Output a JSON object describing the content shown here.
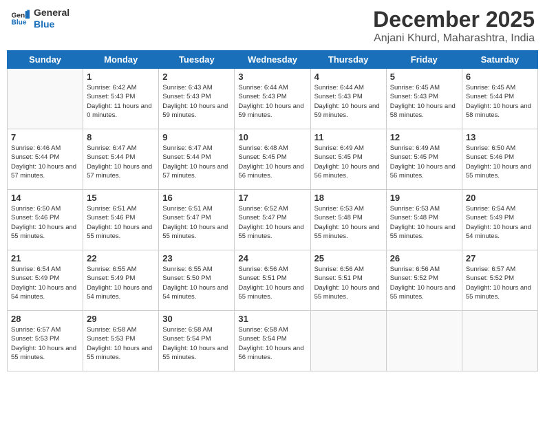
{
  "header": {
    "logo_line1": "General",
    "logo_line2": "Blue",
    "month": "December 2025",
    "location": "Anjani Khurd, Maharashtra, India"
  },
  "weekdays": [
    "Sunday",
    "Monday",
    "Tuesday",
    "Wednesday",
    "Thursday",
    "Friday",
    "Saturday"
  ],
  "weeks": [
    [
      {
        "day": "",
        "sunrise": "",
        "sunset": "",
        "daylight": ""
      },
      {
        "day": "1",
        "sunrise": "6:42 AM",
        "sunset": "5:43 PM",
        "daylight": "11 hours and 0 minutes."
      },
      {
        "day": "2",
        "sunrise": "6:43 AM",
        "sunset": "5:43 PM",
        "daylight": "10 hours and 59 minutes."
      },
      {
        "day": "3",
        "sunrise": "6:44 AM",
        "sunset": "5:43 PM",
        "daylight": "10 hours and 59 minutes."
      },
      {
        "day": "4",
        "sunrise": "6:44 AM",
        "sunset": "5:43 PM",
        "daylight": "10 hours and 59 minutes."
      },
      {
        "day": "5",
        "sunrise": "6:45 AM",
        "sunset": "5:43 PM",
        "daylight": "10 hours and 58 minutes."
      },
      {
        "day": "6",
        "sunrise": "6:45 AM",
        "sunset": "5:44 PM",
        "daylight": "10 hours and 58 minutes."
      }
    ],
    [
      {
        "day": "7",
        "sunrise": "6:46 AM",
        "sunset": "5:44 PM",
        "daylight": "10 hours and 57 minutes."
      },
      {
        "day": "8",
        "sunrise": "6:47 AM",
        "sunset": "5:44 PM",
        "daylight": "10 hours and 57 minutes."
      },
      {
        "day": "9",
        "sunrise": "6:47 AM",
        "sunset": "5:44 PM",
        "daylight": "10 hours and 57 minutes."
      },
      {
        "day": "10",
        "sunrise": "6:48 AM",
        "sunset": "5:45 PM",
        "daylight": "10 hours and 56 minutes."
      },
      {
        "day": "11",
        "sunrise": "6:49 AM",
        "sunset": "5:45 PM",
        "daylight": "10 hours and 56 minutes."
      },
      {
        "day": "12",
        "sunrise": "6:49 AM",
        "sunset": "5:45 PM",
        "daylight": "10 hours and 56 minutes."
      },
      {
        "day": "13",
        "sunrise": "6:50 AM",
        "sunset": "5:46 PM",
        "daylight": "10 hours and 55 minutes."
      }
    ],
    [
      {
        "day": "14",
        "sunrise": "6:50 AM",
        "sunset": "5:46 PM",
        "daylight": "10 hours and 55 minutes."
      },
      {
        "day": "15",
        "sunrise": "6:51 AM",
        "sunset": "5:46 PM",
        "daylight": "10 hours and 55 minutes."
      },
      {
        "day": "16",
        "sunrise": "6:51 AM",
        "sunset": "5:47 PM",
        "daylight": "10 hours and 55 minutes."
      },
      {
        "day": "17",
        "sunrise": "6:52 AM",
        "sunset": "5:47 PM",
        "daylight": "10 hours and 55 minutes."
      },
      {
        "day": "18",
        "sunrise": "6:53 AM",
        "sunset": "5:48 PM",
        "daylight": "10 hours and 55 minutes."
      },
      {
        "day": "19",
        "sunrise": "6:53 AM",
        "sunset": "5:48 PM",
        "daylight": "10 hours and 55 minutes."
      },
      {
        "day": "20",
        "sunrise": "6:54 AM",
        "sunset": "5:49 PM",
        "daylight": "10 hours and 54 minutes."
      }
    ],
    [
      {
        "day": "21",
        "sunrise": "6:54 AM",
        "sunset": "5:49 PM",
        "daylight": "10 hours and 54 minutes."
      },
      {
        "day": "22",
        "sunrise": "6:55 AM",
        "sunset": "5:49 PM",
        "daylight": "10 hours and 54 minutes."
      },
      {
        "day": "23",
        "sunrise": "6:55 AM",
        "sunset": "5:50 PM",
        "daylight": "10 hours and 54 minutes."
      },
      {
        "day": "24",
        "sunrise": "6:56 AM",
        "sunset": "5:51 PM",
        "daylight": "10 hours and 55 minutes."
      },
      {
        "day": "25",
        "sunrise": "6:56 AM",
        "sunset": "5:51 PM",
        "daylight": "10 hours and 55 minutes."
      },
      {
        "day": "26",
        "sunrise": "6:56 AM",
        "sunset": "5:52 PM",
        "daylight": "10 hours and 55 minutes."
      },
      {
        "day": "27",
        "sunrise": "6:57 AM",
        "sunset": "5:52 PM",
        "daylight": "10 hours and 55 minutes."
      }
    ],
    [
      {
        "day": "28",
        "sunrise": "6:57 AM",
        "sunset": "5:53 PM",
        "daylight": "10 hours and 55 minutes."
      },
      {
        "day": "29",
        "sunrise": "6:58 AM",
        "sunset": "5:53 PM",
        "daylight": "10 hours and 55 minutes."
      },
      {
        "day": "30",
        "sunrise": "6:58 AM",
        "sunset": "5:54 PM",
        "daylight": "10 hours and 55 minutes."
      },
      {
        "day": "31",
        "sunrise": "6:58 AM",
        "sunset": "5:54 PM",
        "daylight": "10 hours and 56 minutes."
      },
      {
        "day": "",
        "sunrise": "",
        "sunset": "",
        "daylight": ""
      },
      {
        "day": "",
        "sunrise": "",
        "sunset": "",
        "daylight": ""
      },
      {
        "day": "",
        "sunrise": "",
        "sunset": "",
        "daylight": ""
      }
    ]
  ]
}
